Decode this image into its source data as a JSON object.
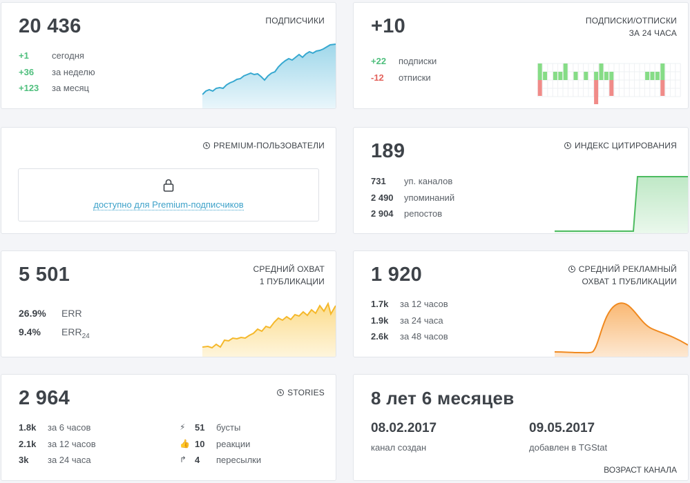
{
  "subscribers": {
    "value": "20 436",
    "title": "подписчики",
    "rows": [
      {
        "value": "+1",
        "label": "сегодня"
      },
      {
        "value": "+36",
        "label": "за неделю"
      },
      {
        "value": "+123",
        "label": "за месяц"
      }
    ],
    "color": "#36a8d0"
  },
  "subs_unsubs": {
    "value": "+10",
    "title_line1": "подписки/отписки",
    "title_line2": "за 24 часа",
    "rows": [
      {
        "value": "+22",
        "label": "подписки"
      },
      {
        "value": "-12",
        "label": "отписки"
      }
    ],
    "chart_data": {
      "type": "bar",
      "series": [
        {
          "values": [
            2,
            1,
            0,
            1,
            1,
            2,
            0,
            1,
            0,
            1,
            0,
            1,
            2,
            1,
            1,
            0,
            0,
            0,
            0,
            0,
            0,
            1,
            1,
            1,
            2,
            0,
            0,
            0
          ]
        },
        {
          "values": [
            1,
            0,
            0,
            0,
            0,
            0,
            0,
            0,
            0,
            0,
            0,
            2,
            0,
            0,
            1,
            0,
            0,
            0,
            0,
            0,
            0,
            0,
            0,
            0,
            1,
            0,
            0,
            0
          ]
        }
      ]
    }
  },
  "premium": {
    "title": "premium-пользователи",
    "link": "доступно для Premium-подписчиков",
    "lock_icon": "lock-icon"
  },
  "citation": {
    "value": "189",
    "title": "индекс цитирования",
    "rows": [
      {
        "value": "731",
        "label": "уп. каналов"
      },
      {
        "value": "2 490",
        "label": "упоминаний"
      },
      {
        "value": "2 904",
        "label": "репостов"
      }
    ],
    "color": "#4cbb5f"
  },
  "reach": {
    "value": "5 501",
    "title_line1": "средний охват",
    "title_line2": "1 публикации",
    "err_value": "26.9%",
    "err_label": "ERR",
    "err24_value": "9.4%",
    "err24_label": "ERR",
    "err24_sub": "24",
    "color": "#f5b82a"
  },
  "ad_reach": {
    "value": "1 920",
    "title_line1": "средний рекламный",
    "title_line2": "охват 1 публикации",
    "rows": [
      {
        "value": "1.7k",
        "label": "за 12 часов"
      },
      {
        "value": "1.9k",
        "label": "за 24 часа"
      },
      {
        "value": "2.6k",
        "label": "за 48 часов"
      }
    ],
    "color": "#f0891f"
  },
  "stories": {
    "value": "2 964",
    "title": "stories",
    "rows": [
      {
        "value": "1.8k",
        "label": "за 6 часов"
      },
      {
        "value": "2.1k",
        "label": "за 12 часов"
      },
      {
        "value": "3k",
        "label": "за 24 часа"
      }
    ],
    "reactions": [
      {
        "icon": "lightning-icon",
        "glyph": "⚡",
        "value": "51",
        "label": "бусты"
      },
      {
        "icon": "thumbs-up-icon",
        "glyph": "👍",
        "value": "10",
        "label": "реакции"
      },
      {
        "icon": "share-arrow-icon",
        "glyph": "↱",
        "value": "4",
        "label": "пересылки"
      }
    ]
  },
  "age": {
    "value": "8 лет 6 месяцев",
    "created_date": "08.02.2017",
    "created_label": "канал создан",
    "added_date": "09.05.2017",
    "added_label": "добавлен в TGStat",
    "title": "возраст канала"
  }
}
